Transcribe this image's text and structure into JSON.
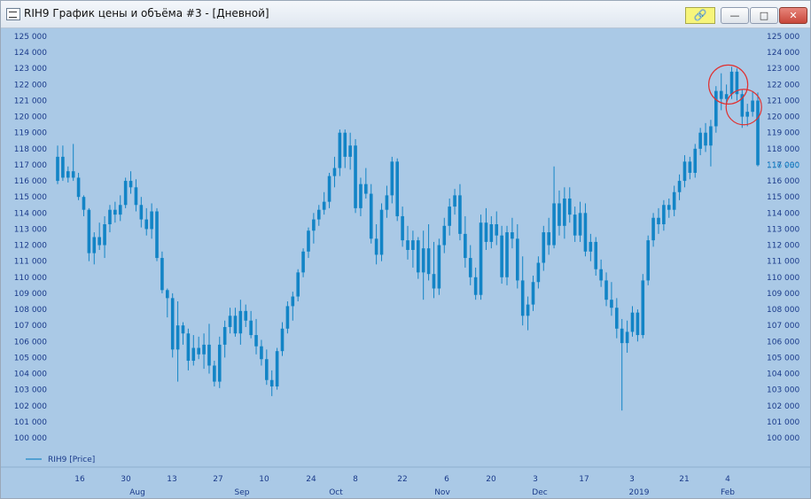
{
  "window": {
    "title": "RIH9 График цены и объёма #3 - [Дневной]",
    "link_icon": "link-icon",
    "minimize_icon": "minimize-icon",
    "maximize_icon": "maximize-icon",
    "close_icon": "close-icon"
  },
  "legend_label": "RIH9 [Price]",
  "chart_data": {
    "type": "candlestick",
    "series_name": "RIH9 [Price]",
    "ylim": [
      100000,
      125000
    ],
    "y_ticks": [
      "125 000",
      "124 000",
      "123 000",
      "122 000",
      "121 000",
      "120 000",
      "119 000",
      "118 000",
      "117 000",
      "116 000",
      "115 000",
      "114 000",
      "113 000",
      "112 000",
      "111 000",
      "110 000",
      "109 000",
      "108 000",
      "107 000",
      "106 000",
      "105 000",
      "104 000",
      "103 000",
      "102 000",
      "101 000",
      "100 000"
    ],
    "y_tick_values": [
      125000,
      124000,
      123000,
      122000,
      121000,
      120000,
      119000,
      118000,
      117000,
      116000,
      115000,
      114000,
      113000,
      112000,
      111000,
      110000,
      109000,
      108000,
      107000,
      106000,
      105000,
      104000,
      103000,
      102000,
      101000,
      100000
    ],
    "last_price_label": "116 980",
    "last_price": 116980,
    "x_ticks": [
      "16",
      "30",
      "13",
      "27",
      "10",
      "24",
      "8",
      "22",
      "6",
      "20",
      "3",
      "17",
      "3",
      "21",
      "4"
    ],
    "month_labels": [
      "Aug",
      "Sep",
      "Oct",
      "Nov",
      "Dec",
      "2019",
      "Feb"
    ],
    "highlight_circles": 2,
    "candles": [
      [
        116000,
        118200,
        115800,
        117500
      ],
      [
        117500,
        118200,
        116000,
        116200
      ],
      [
        116200,
        116900,
        115900,
        116600
      ],
      [
        116600,
        118300,
        116000,
        116200
      ],
      [
        116200,
        116500,
        114800,
        115000
      ],
      [
        115000,
        115100,
        113800,
        114200
      ],
      [
        114200,
        114300,
        111000,
        111500
      ],
      [
        111500,
        112800,
        110800,
        112500
      ],
      [
        112500,
        113400,
        111700,
        112000
      ],
      [
        112000,
        113800,
        111200,
        113300
      ],
      [
        113300,
        114500,
        112800,
        114200
      ],
      [
        114200,
        114700,
        113400,
        113900
      ],
      [
        113900,
        115100,
        113500,
        114500
      ],
      [
        114500,
        116200,
        114300,
        116000
      ],
      [
        116000,
        116600,
        115200,
        115600
      ],
      [
        115600,
        116100,
        114100,
        114500
      ],
      [
        114500,
        115000,
        113100,
        113600
      ],
      [
        113600,
        114300,
        112600,
        113000
      ],
      [
        113000,
        114600,
        112400,
        114100
      ],
      [
        114100,
        114300,
        111000,
        111200
      ],
      [
        111200,
        111600,
        109000,
        109200
      ],
      [
        109200,
        109300,
        107500,
        108700
      ],
      [
        108700,
        109000,
        105000,
        105500
      ],
      [
        105500,
        108500,
        103500,
        107000
      ],
      [
        107000,
        107200,
        105800,
        106500
      ],
      [
        106500,
        106800,
        104200,
        104800
      ],
      [
        104800,
        106400,
        104500,
        105600
      ],
      [
        105600,
        106300,
        104900,
        105200
      ],
      [
        105200,
        106500,
        104300,
        105800
      ],
      [
        105800,
        107100,
        104000,
        104500
      ],
      [
        104500,
        104800,
        103200,
        103500
      ],
      [
        103500,
        106300,
        103100,
        105800
      ],
      [
        105800,
        107300,
        105000,
        106900
      ],
      [
        106900,
        108100,
        106500,
        107600
      ],
      [
        107600,
        108100,
        106300,
        106500
      ],
      [
        106500,
        108600,
        105800,
        107900
      ],
      [
        107900,
        108300,
        106900,
        107300
      ],
      [
        107300,
        107900,
        106200,
        106400
      ],
      [
        106400,
        107400,
        105200,
        105700
      ],
      [
        105700,
        106100,
        104500,
        104900
      ],
      [
        104900,
        105500,
        103300,
        103600
      ],
      [
        103600,
        104200,
        102600,
        103200
      ],
      [
        103200,
        105600,
        103000,
        105400
      ],
      [
        105400,
        107200,
        105100,
        106800
      ],
      [
        106800,
        108500,
        106500,
        108200
      ],
      [
        108200,
        109100,
        107300,
        108800
      ],
      [
        108800,
        110500,
        108500,
        110300
      ],
      [
        110300,
        111800,
        110000,
        111600
      ],
      [
        111600,
        113100,
        111200,
        112900
      ],
      [
        112900,
        114000,
        112100,
        113600
      ],
      [
        113600,
        114500,
        113200,
        114200
      ],
      [
        114200,
        115300,
        113900,
        114700
      ],
      [
        114700,
        116500,
        114300,
        116300
      ],
      [
        116300,
        117500,
        115600,
        116800
      ],
      [
        116800,
        119200,
        116300,
        119000
      ],
      [
        119000,
        119200,
        116800,
        117500
      ],
      [
        117500,
        119000,
        116700,
        118200
      ],
      [
        118200,
        118600,
        114000,
        114300
      ],
      [
        114300,
        116200,
        113800,
        115800
      ],
      [
        115800,
        116800,
        114900,
        115200
      ],
      [
        115200,
        115800,
        112100,
        112400
      ],
      [
        112400,
        113300,
        110800,
        111400
      ],
      [
        111400,
        114600,
        111000,
        114200
      ],
      [
        114200,
        115700,
        113700,
        115100
      ],
      [
        115100,
        117500,
        114600,
        117200
      ],
      [
        117200,
        117400,
        113500,
        113800
      ],
      [
        113800,
        114400,
        111900,
        112300
      ],
      [
        112300,
        113200,
        111100,
        111700
      ],
      [
        111700,
        112900,
        110600,
        112300
      ],
      [
        112300,
        112500,
        109900,
        110300
      ],
      [
        110300,
        112900,
        108600,
        111800
      ],
      [
        111800,
        113300,
        109800,
        110200
      ],
      [
        110200,
        112200,
        108700,
        109300
      ],
      [
        109300,
        112400,
        108900,
        112000
      ],
      [
        112000,
        113700,
        111500,
        113200
      ],
      [
        113200,
        114900,
        112600,
        114400
      ],
      [
        114400,
        115500,
        113900,
        115100
      ],
      [
        115100,
        115800,
        112300,
        112700
      ],
      [
        112700,
        113800,
        110600,
        111200
      ],
      [
        111200,
        112000,
        109500,
        110000
      ],
      [
        110000,
        110600,
        108600,
        108900
      ],
      [
        108900,
        113900,
        108600,
        113400
      ],
      [
        113400,
        114300,
        111700,
        112200
      ],
      [
        112200,
        113800,
        111800,
        113300
      ],
      [
        113300,
        114100,
        112000,
        112600
      ],
      [
        112600,
        113200,
        109600,
        110000
      ],
      [
        110000,
        113200,
        109500,
        112800
      ],
      [
        112800,
        113700,
        111800,
        112400
      ],
      [
        112400,
        113300,
        109300,
        109800
      ],
      [
        109800,
        111300,
        107000,
        107600
      ],
      [
        107600,
        108800,
        106700,
        108300
      ],
      [
        108300,
        110100,
        107900,
        109700
      ],
      [
        109700,
        111300,
        109300,
        110900
      ],
      [
        110900,
        113200,
        110400,
        112800
      ],
      [
        112800,
        113700,
        111400,
        112000
      ],
      [
        112000,
        116900,
        111800,
        114600
      ],
      [
        114600,
        115400,
        112600,
        113200
      ],
      [
        113200,
        115600,
        112400,
        114900
      ],
      [
        114900,
        115600,
        113400,
        113900
      ],
      [
        113900,
        114400,
        112200,
        112600
      ],
      [
        112600,
        114700,
        112200,
        114000
      ],
      [
        114000,
        114600,
        111300,
        111600
      ],
      [
        111600,
        112700,
        111000,
        112200
      ],
      [
        112200,
        112500,
        110100,
        110500
      ],
      [
        110500,
        111100,
        109400,
        109800
      ],
      [
        109800,
        110300,
        108200,
        108600
      ],
      [
        108600,
        109700,
        107600,
        108100
      ],
      [
        108100,
        108700,
        106200,
        106800
      ],
      [
        106800,
        107400,
        101700,
        105900
      ],
      [
        105900,
        107300,
        105300,
        106600
      ],
      [
        106600,
        108200,
        106300,
        107800
      ],
      [
        107800,
        108000,
        106000,
        106400
      ],
      [
        106400,
        110200,
        106200,
        109800
      ],
      [
        109800,
        112600,
        109500,
        112300
      ],
      [
        112300,
        114000,
        111900,
        113700
      ],
      [
        113700,
        114300,
        112700,
        113300
      ],
      [
        113300,
        114800,
        112900,
        114500
      ],
      [
        114500,
        114900,
        113700,
        114200
      ],
      [
        114200,
        115700,
        113800,
        115300
      ],
      [
        115300,
        116400,
        114800,
        116000
      ],
      [
        116000,
        117600,
        115600,
        117200
      ],
      [
        117200,
        117500,
        116100,
        116500
      ],
      [
        116500,
        118300,
        116200,
        118000
      ],
      [
        118000,
        119300,
        117600,
        119000
      ],
      [
        119000,
        119600,
        117800,
        118200
      ],
      [
        118200,
        119800,
        116900,
        119400
      ],
      [
        119400,
        121900,
        119000,
        121600
      ],
      [
        121600,
        122700,
        120400,
        121100
      ],
      [
        121100,
        122000,
        120800,
        121400
      ],
      [
        121400,
        123100,
        121100,
        122800
      ],
      [
        122800,
        123000,
        121000,
        121400
      ],
      [
        121400,
        121700,
        119300,
        120000
      ],
      [
        120000,
        120800,
        119400,
        120300
      ],
      [
        120300,
        121600,
        120000,
        121000
      ],
      [
        121000,
        121500,
        116900,
        116980
      ]
    ]
  }
}
